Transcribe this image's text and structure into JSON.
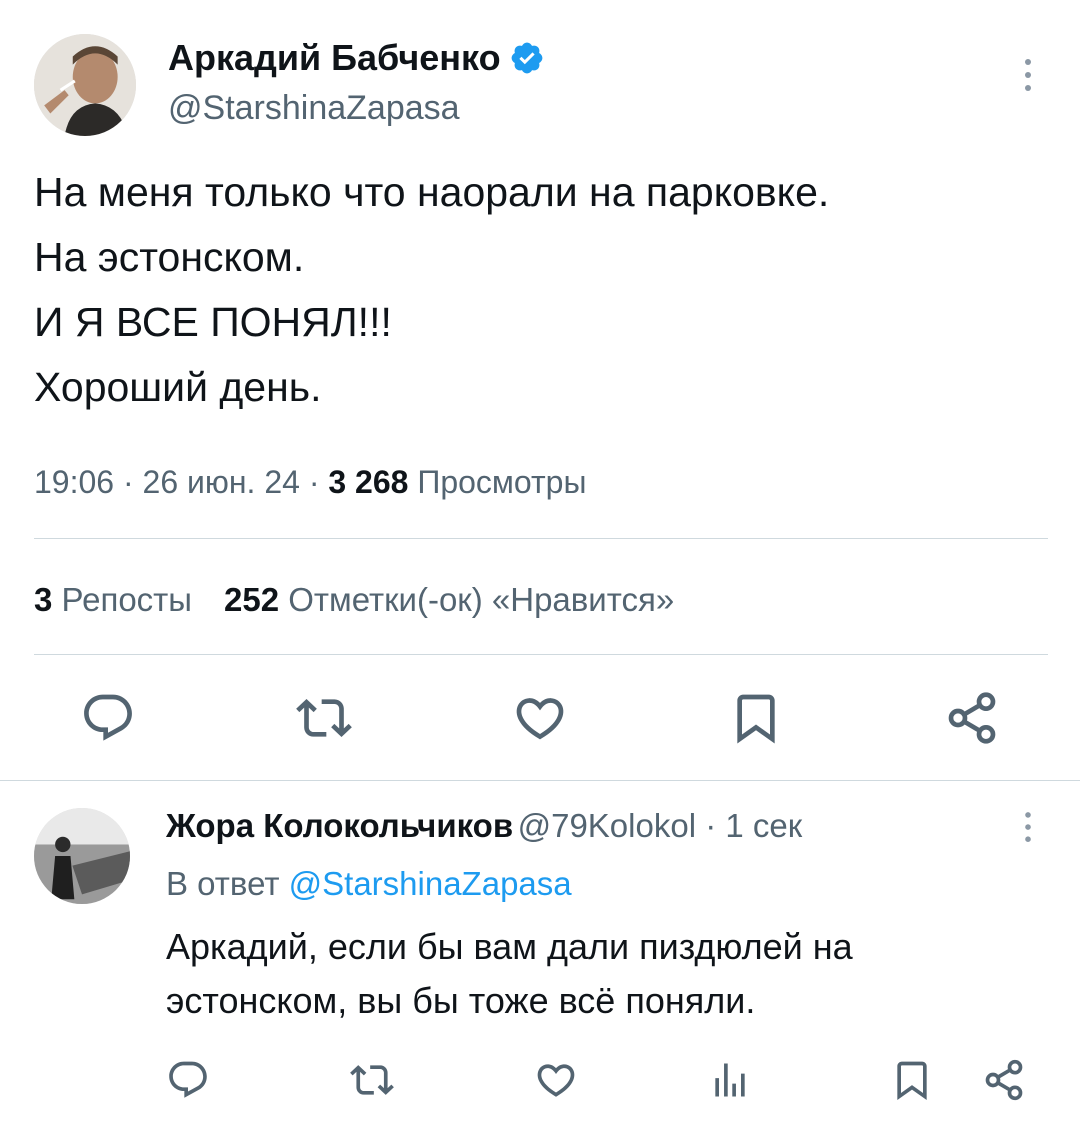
{
  "main_tweet": {
    "author_name": "Аркадий Бабченко",
    "handle": "@StarshinaZapasa",
    "text_lines": [
      "На меня только что наорали на парковке.",
      "На эстонском.",
      "И Я ВСЕ ПОНЯЛ!!!",
      "Хороший день."
    ],
    "time": "19:06",
    "separator": " · ",
    "date": "26 июн. 24",
    "views_count": "3 268",
    "views_label": "Просмотры",
    "reposts_count": "3",
    "reposts_label": "Репосты",
    "likes_count": "252",
    "likes_label": "Отметки(-ок) «Нравится»"
  },
  "reply": {
    "author_name": "Жора Колокольчиков",
    "handle": "@79Kolokol",
    "separator": " · ",
    "time_ago": "1 сек",
    "reply_to_prefix": "В ответ",
    "reply_to_handle": "@StarshinaZapasa",
    "text_lines": [
      "Аркадий, если бы вам дали пиздюлей на",
      "эстонском, вы бы тоже всё поняли."
    ]
  },
  "icons": {
    "main_actions": [
      "reply-icon",
      "repost-icon",
      "like-icon",
      "bookmark-icon",
      "share-icon"
    ],
    "reply_actions": [
      "reply-icon",
      "repost-icon",
      "like-icon",
      "views-icon",
      "bookmark-icon",
      "share-icon"
    ],
    "verified": "verified-badge-icon",
    "more": "more-options-icon"
  },
  "colors": {
    "accent": "#1d9bf0",
    "text_primary": "#0f1419",
    "text_secondary": "#536471",
    "divider": "#cfd9de",
    "icon": "#536471"
  }
}
